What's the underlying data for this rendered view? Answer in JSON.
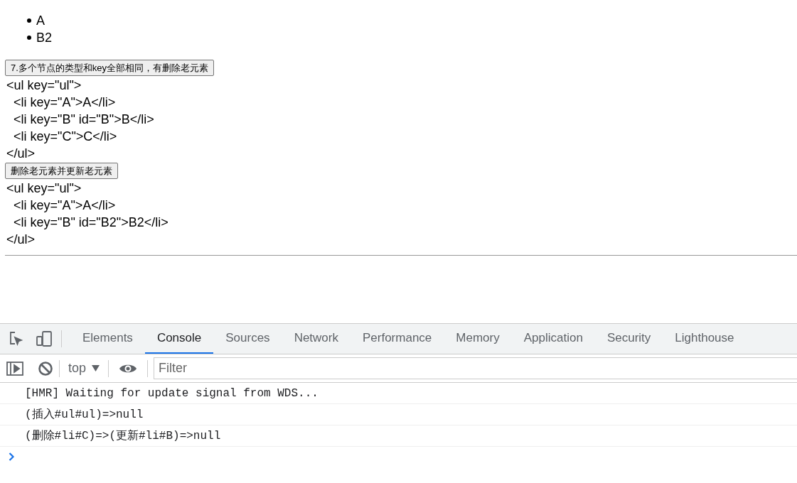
{
  "page": {
    "list_items": [
      "A",
      "B2"
    ],
    "sections": [
      {
        "button": "7.多个节点的类型和key全部相同，有删除老元素",
        "code_lines": [
          "<ul key=\"ul\">",
          "  <li key=\"A\">A</li>",
          "  <li key=\"B\" id=\"B\">B</li>",
          "  <li key=\"C\">C</li>",
          "</ul>"
        ]
      },
      {
        "button": "删除老元素并更新老元素",
        "code_lines": [
          "<ul key=\"ul\">",
          "  <li key=\"A\">A</li>",
          "  <li key=\"B\" id=\"B2\">B2</li>",
          "</ul>"
        ]
      }
    ]
  },
  "devtools": {
    "tabs": [
      {
        "label": "Elements",
        "selected": false
      },
      {
        "label": "Console",
        "selected": true
      },
      {
        "label": "Sources",
        "selected": false
      },
      {
        "label": "Network",
        "selected": false
      },
      {
        "label": "Performance",
        "selected": false
      },
      {
        "label": "Memory",
        "selected": false
      },
      {
        "label": "Application",
        "selected": false
      },
      {
        "label": "Security",
        "selected": false
      },
      {
        "label": "Lighthouse",
        "selected": false
      }
    ],
    "context": "top",
    "filter": {
      "placeholder": "Filter"
    },
    "messages": [
      "[HMR] Waiting for update signal from WDS...",
      "(插入#ul#ul)=>null",
      "(删除#li#C)=>(更新#li#B)=>null"
    ]
  }
}
